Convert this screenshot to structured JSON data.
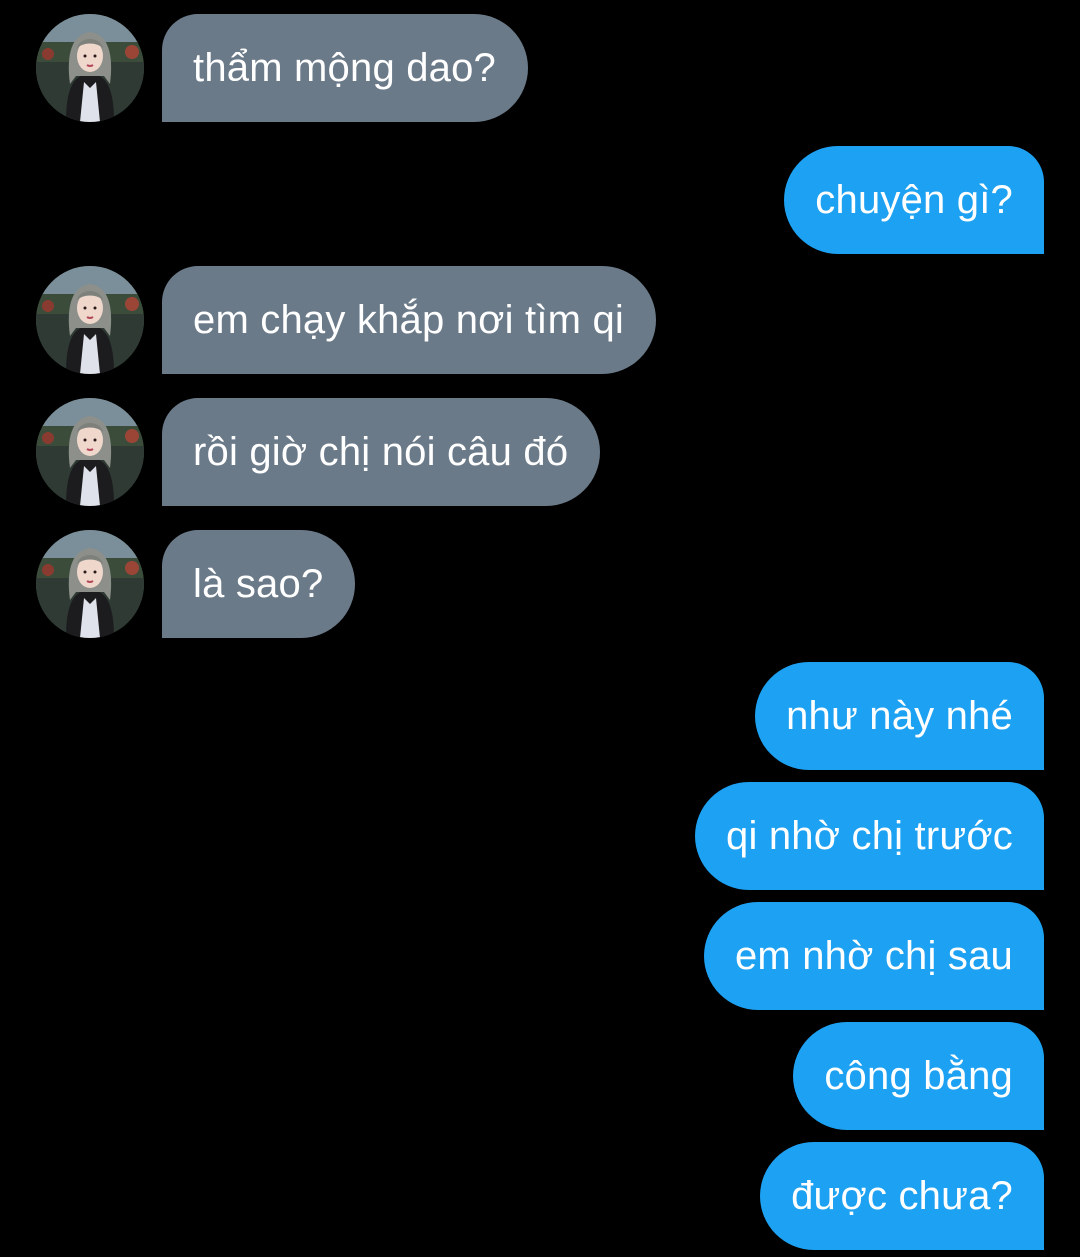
{
  "conversation": {
    "incoming_bubble_color": "#6b7a89",
    "outgoing_bubble_color": "#1da1f2",
    "background_color": "#000000",
    "messages": [
      {
        "direction": "in",
        "text": "thẩm mộng dao?"
      },
      {
        "direction": "out",
        "text": "chuyện gì?"
      },
      {
        "direction": "in",
        "text": "em chạy khắp nơi tìm qi"
      },
      {
        "direction": "in",
        "text": "rồi giờ chị nói câu đó"
      },
      {
        "direction": "in",
        "text": "là sao?"
      },
      {
        "direction": "out",
        "text": "như này nhé"
      },
      {
        "direction": "out",
        "text": "qi nhờ chị trước "
      },
      {
        "direction": "out",
        "text": "em nhờ chị sau"
      },
      {
        "direction": "out",
        "text": "công bằng"
      },
      {
        "direction": "out",
        "text": "được chưa?"
      }
    ]
  },
  "avatar": {
    "icon": "contact-photo-icon"
  }
}
